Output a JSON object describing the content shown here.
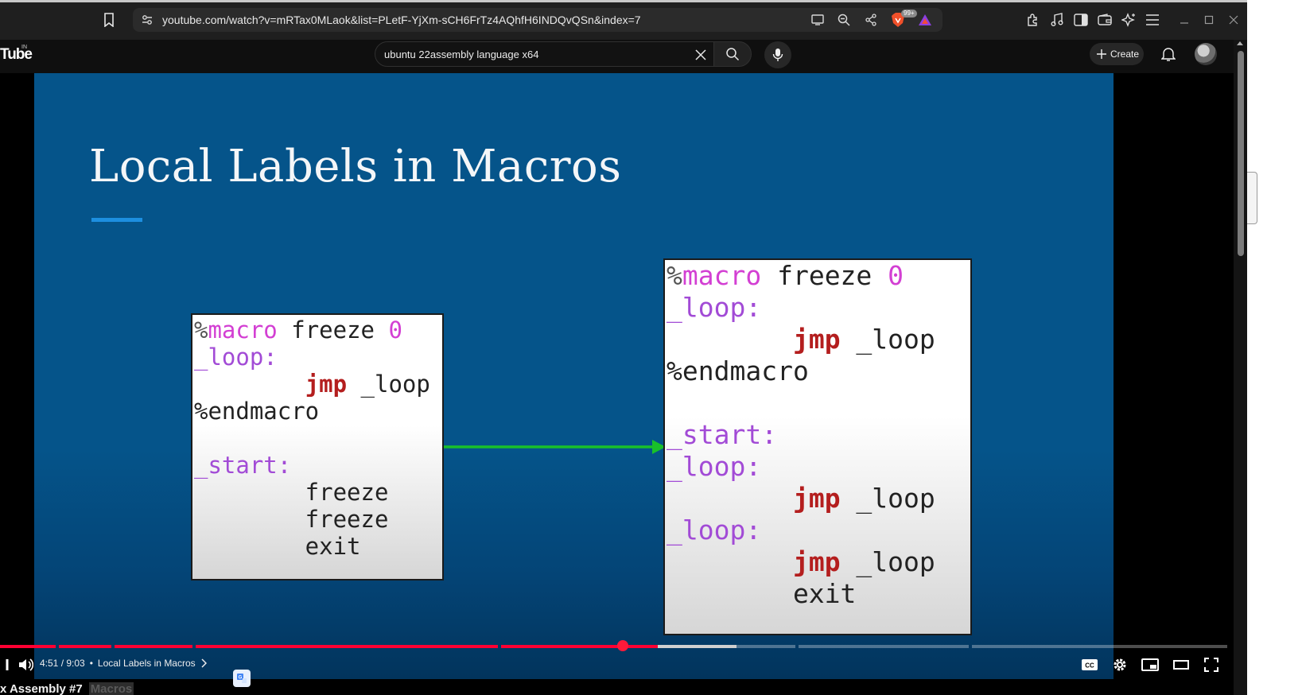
{
  "browser": {
    "url": "youtube.com/watch?v=mRTax0MLaok&list=PLetF-YjXm-sCH6FrTz4AQhfH6INDQvQSn&index=7",
    "brave_badge": "99+"
  },
  "youtube": {
    "logo_fragment": "Tube",
    "logo_country": "IN",
    "search_value": "ubuntu 22assembly language x64",
    "create_label": "Create"
  },
  "slide": {
    "title": "Local Labels in Macros",
    "left_code": [
      [
        {
          "t": "%",
          "c": "pct"
        },
        {
          "t": "macro",
          "c": "magenta"
        },
        {
          "t": " freeze ",
          "c": "plain"
        },
        {
          "t": "0",
          "c": "magenta"
        }
      ],
      [
        {
          "t": "_loop:",
          "c": "purple"
        }
      ],
      [
        {
          "t": "        ",
          "c": "plain"
        },
        {
          "t": "jmp",
          "c": "red"
        },
        {
          "t": " _loop",
          "c": "plain"
        }
      ],
      [
        {
          "t": "%endmacro",
          "c": "plain"
        }
      ],
      [
        {
          "t": "",
          "c": "plain"
        }
      ],
      [
        {
          "t": "_start:",
          "c": "purple"
        }
      ],
      [
        {
          "t": "        freeze",
          "c": "plain"
        }
      ],
      [
        {
          "t": "        freeze",
          "c": "plain"
        }
      ],
      [
        {
          "t": "        exit",
          "c": "plain"
        }
      ]
    ],
    "right_code": [
      [
        {
          "t": "%",
          "c": "pct"
        },
        {
          "t": "macro",
          "c": "magenta"
        },
        {
          "t": " freeze ",
          "c": "plain"
        },
        {
          "t": "0",
          "c": "magenta"
        }
      ],
      [
        {
          "t": "_loop:",
          "c": "purple"
        }
      ],
      [
        {
          "t": "        ",
          "c": "plain"
        },
        {
          "t": "jmp",
          "c": "red"
        },
        {
          "t": " _loop",
          "c": "plain"
        }
      ],
      [
        {
          "t": "%endmacro",
          "c": "plain"
        }
      ],
      [
        {
          "t": "",
          "c": "plain"
        }
      ],
      [
        {
          "t": "_start:",
          "c": "purple"
        }
      ],
      [
        {
          "t": "_loop:",
          "c": "purple"
        }
      ],
      [
        {
          "t": "        ",
          "c": "plain"
        },
        {
          "t": "jmp",
          "c": "red"
        },
        {
          "t": " _loop",
          "c": "plain"
        }
      ],
      [
        {
          "t": "_loop:",
          "c": "purple"
        }
      ],
      [
        {
          "t": "        ",
          "c": "plain"
        },
        {
          "t": "jmp",
          "c": "red"
        },
        {
          "t": " _loop",
          "c": "plain"
        }
      ],
      [
        {
          "t": "        exit",
          "c": "plain"
        }
      ]
    ],
    "arrow_color": "#19c02a"
  },
  "player": {
    "time": "4:51 / 9:03",
    "chapter": "Local Labels in Macros",
    "progress_fraction": 0.536,
    "buffered_fraction": 0.6
  },
  "below": {
    "title_fragment": "x Assembly #7",
    "chip_fragment": "Macros"
  },
  "colors": {
    "accent_red": "#ff0033",
    "slide_bg": "#05548a",
    "title_underline": "#1d8fe0"
  }
}
